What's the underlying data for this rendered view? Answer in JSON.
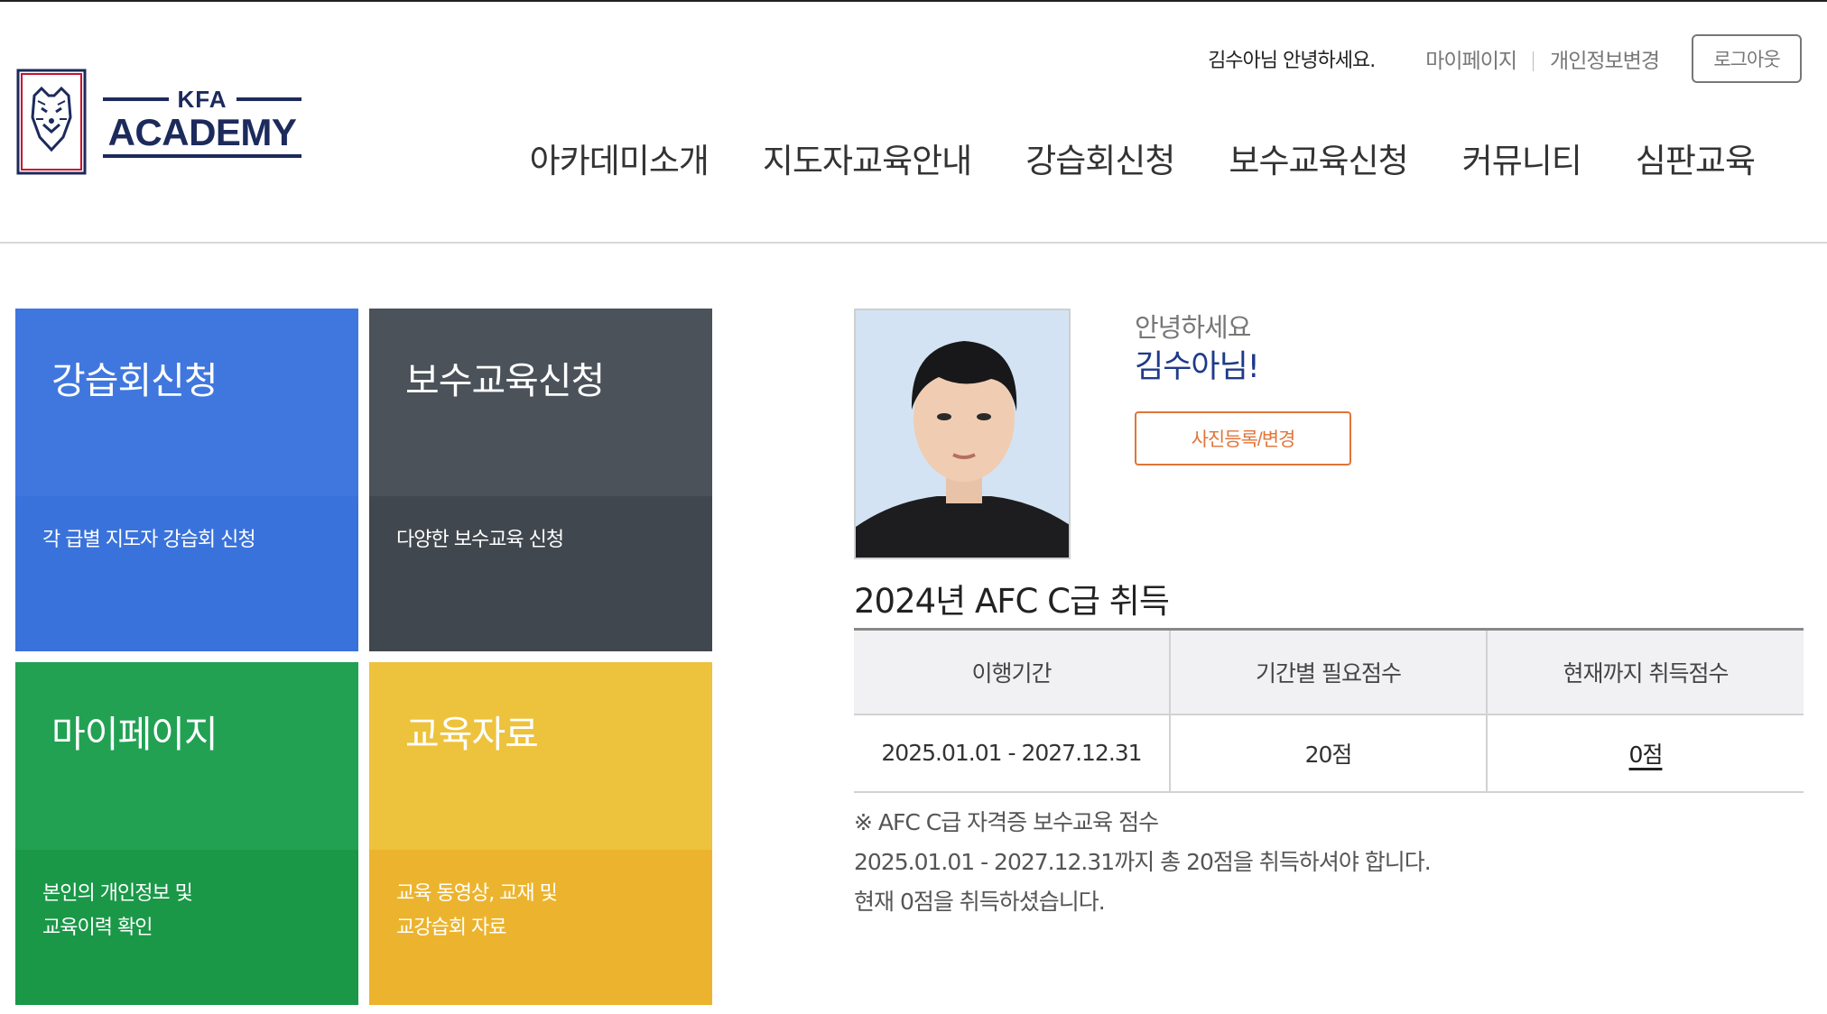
{
  "header": {
    "logo": {
      "small_text": "KFA",
      "main_text": "ACADEMY"
    },
    "greeting": "김수아님 안녕하세요.",
    "util_links": [
      "마이페이지",
      "개인정보변경"
    ],
    "logout_label": "로그아웃",
    "nav": [
      "아카데미소개",
      "지도자교육안내",
      "강습회신청",
      "보수교육신청",
      "커뮤니티",
      "심판교육"
    ]
  },
  "tiles": [
    {
      "title": "강습회신청",
      "desc_lines": [
        "각 급별 지도자 강습회 신청"
      ]
    },
    {
      "title": "보수교육신청",
      "desc_lines": [
        "다양한 보수교육 신청"
      ]
    },
    {
      "title": "마이페이지",
      "desc_lines": [
        "본인의 개인정보 및",
        "교육이력 확인"
      ]
    },
    {
      "title": "교육자료",
      "desc_lines": [
        "교육 동영상, 교재 및",
        "교강습회 자료"
      ]
    }
  ],
  "profile": {
    "hello": "안녕하세요",
    "name": "김수아님!",
    "photo_button": "사진등록/변경"
  },
  "certificate": {
    "title": "2024년 AFC C급 취득",
    "columns": [
      "이행기간",
      "기간별 필요점수",
      "현재까지 취득점수"
    ],
    "row": {
      "period": "2025.01.01 - 2027.12.31",
      "required": "20점",
      "earned": "0점"
    },
    "notes": [
      "※ AFC C급 자격증 보수교육 점수",
      "2025.01.01 - 2027.12.31까지 총 20점을 취득하셔야 합니다.",
      "현재 0점을 취득하셨습니다."
    ]
  },
  "colors": {
    "brand_navy": "#1c2a5c",
    "tile_blue": "#4077de",
    "tile_gray": "#4b5259",
    "tile_green": "#22a153",
    "tile_yellow": "#edc23d",
    "accent_orange": "#e0753a"
  }
}
